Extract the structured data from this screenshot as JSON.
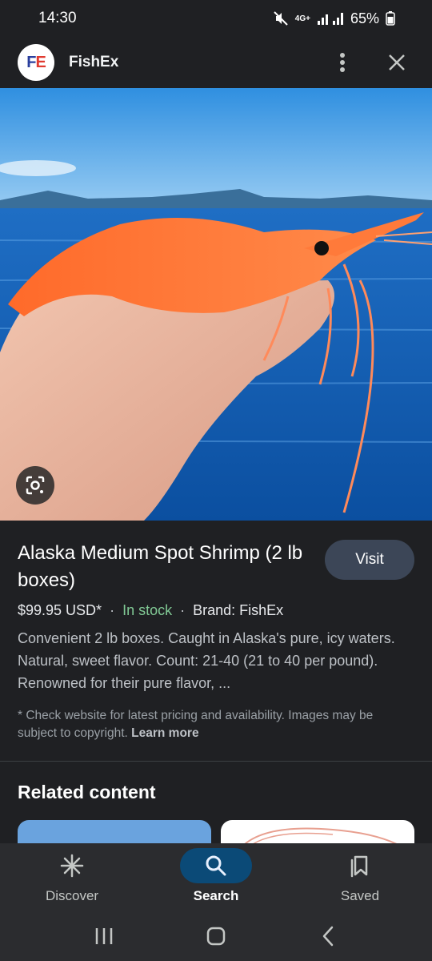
{
  "status_bar": {
    "time": "14:30",
    "network": "4G+",
    "battery": "65%"
  },
  "header": {
    "logo_letter_1": "F",
    "logo_letter_2": "E",
    "site_name": "FishEx"
  },
  "product": {
    "title": "Alaska Medium Spot Shrimp (2 lb boxes)",
    "visit_label": "Visit",
    "price": "$99.95 USD*",
    "stock": "In stock",
    "brand": "Brand: FishEx",
    "description": "Convenient 2 lb boxes. Caught in Alaska's pure, icy waters. Natural, sweet flavor. Count: 21-40 (21 to 40 per pound). Renowned for their pure flavor, ...",
    "disclaimer": "* Check website for latest pricing and availability. Images may be subject to copyright.",
    "learn_more": "Learn more"
  },
  "related": {
    "title": "Related content"
  },
  "bottom_nav": {
    "items": [
      {
        "label": "Discover",
        "icon": "discover-asterisk-icon"
      },
      {
        "label": "Search",
        "icon": "search-icon"
      },
      {
        "label": "Saved",
        "icon": "saved-bookmarks-icon"
      }
    ],
    "active": "Search"
  },
  "colors": {
    "background": "#1f2023",
    "in_stock": "#81c995",
    "visit_button": "#3c4657",
    "active_nav_pill": "#0b4a77"
  }
}
